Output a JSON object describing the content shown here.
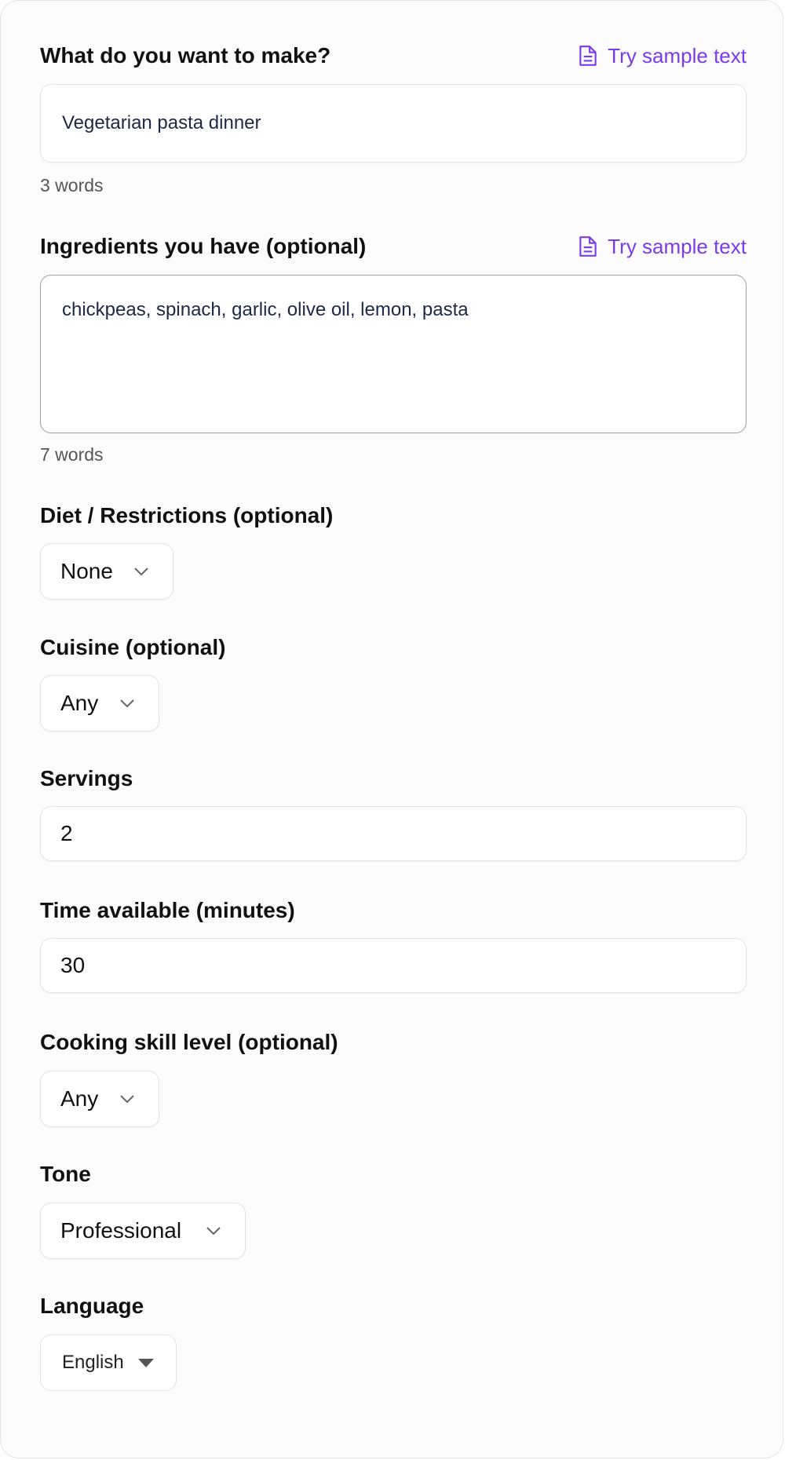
{
  "make": {
    "label": "What do you want to make?",
    "sample_link": "Try sample text",
    "value": "Vegetarian pasta dinner",
    "word_count": "3 words"
  },
  "ingredients": {
    "label": "Ingredients you have (optional)",
    "sample_link": "Try sample text",
    "value": "chickpeas, spinach, garlic, olive oil, lemon, pasta",
    "word_count": "7 words"
  },
  "diet": {
    "label": "Diet / Restrictions (optional)",
    "selected": "None"
  },
  "cuisine": {
    "label": "Cuisine (optional)",
    "selected": "Any"
  },
  "servings": {
    "label": "Servings",
    "value": "2"
  },
  "time": {
    "label": "Time available (minutes)",
    "value": "30"
  },
  "skill": {
    "label": "Cooking skill level (optional)",
    "selected": "Any"
  },
  "tone": {
    "label": "Tone",
    "selected": "Professional"
  },
  "language": {
    "label": "Language",
    "selected": "English"
  },
  "colors": {
    "accent": "#7c3aed",
    "border": "#e4e4e7",
    "text": "#111111"
  },
  "icons": {
    "sample": "document-icon",
    "dropdown": "chevron-down-icon",
    "native_dropdown": "caret-down-icon"
  }
}
